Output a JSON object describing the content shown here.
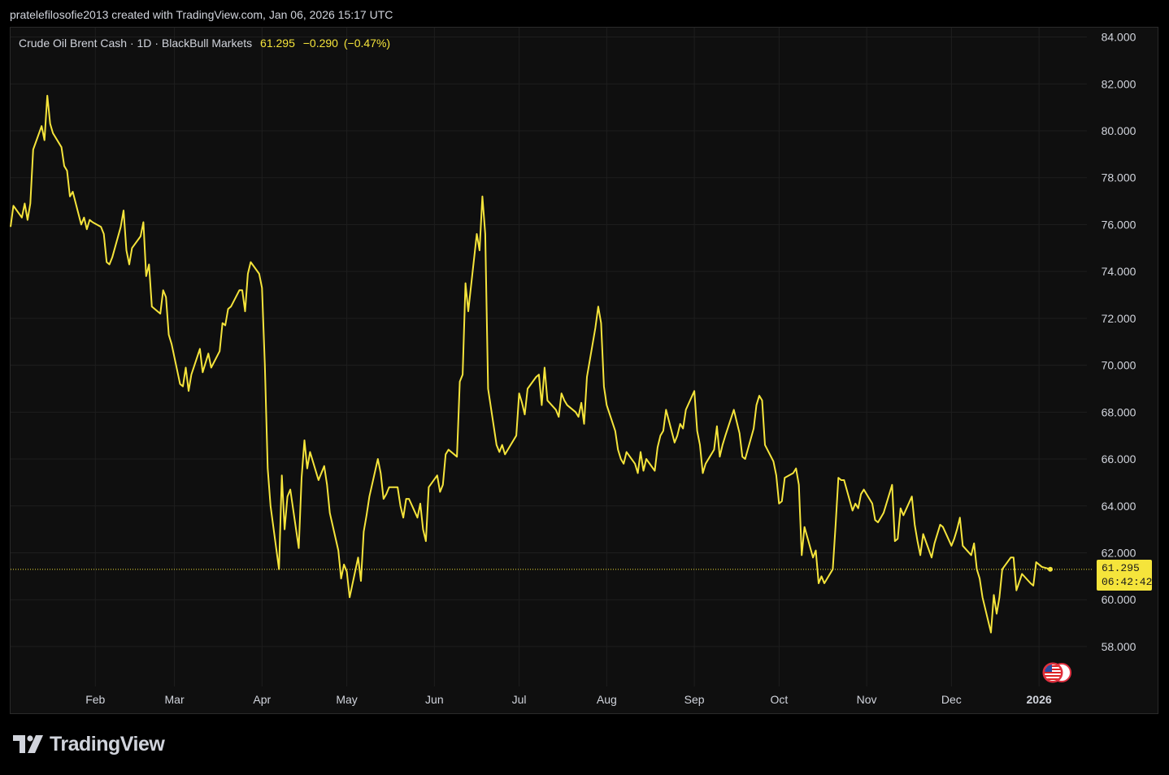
{
  "header": {
    "attribution": "pratelefilosofie2013 created with TradingView.com, Jan 06, 2026 15:17 UTC"
  },
  "legend": {
    "symbol": "Crude Oil Brent Cash",
    "sep1": "·",
    "interval": "1D",
    "sep2": "·",
    "source": "BlackBull Markets",
    "last": "61.295",
    "change": "−0.290",
    "change_pct": "(−0.47%)"
  },
  "price_tag": {
    "price": "61.295",
    "countdown": "06:42:42"
  },
  "logo": {
    "text": "TradingView"
  },
  "icons": {
    "logo": "tradingview-logo-icon",
    "flags": "us-flag-icon"
  },
  "colors": {
    "line": "#f5e43b",
    "background": "#0f0f0f",
    "grid": "#1e1e1e",
    "axis_text": "#d1d4dc"
  },
  "chart_data": {
    "type": "line",
    "title": "",
    "xlabel": "",
    "ylabel": "",
    "ylim": [
      56.3,
      84.4
    ],
    "y_ticks": [
      "58.000",
      "60.000",
      "62.000",
      "64.000",
      "66.000",
      "68.000",
      "70.000",
      "72.000",
      "74.000",
      "76.000",
      "78.000",
      "80.000",
      "82.000",
      "84.000"
    ],
    "x_ticks": [
      {
        "label": "Feb",
        "date": "2025-02-01"
      },
      {
        "label": "Mar",
        "date": "2025-03-01"
      },
      {
        "label": "Apr",
        "date": "2025-04-01"
      },
      {
        "label": "May",
        "date": "2025-05-01"
      },
      {
        "label": "Jun",
        "date": "2025-06-01"
      },
      {
        "label": "Jul",
        "date": "2025-07-01"
      },
      {
        "label": "Aug",
        "date": "2025-08-01"
      },
      {
        "label": "Sep",
        "date": "2025-09-01"
      },
      {
        "label": "Oct",
        "date": "2025-10-01"
      },
      {
        "label": "Nov",
        "date": "2025-11-01"
      },
      {
        "label": "Dec",
        "date": "2025-12-01"
      },
      {
        "label": "2026",
        "date": "2026-01-01",
        "bold": true
      }
    ],
    "last_price": 61.295,
    "grid": true,
    "series": [
      {
        "values": [
          [
            "2025-01-02",
            75.9
          ],
          [
            "2025-01-03",
            76.8
          ],
          [
            "2025-01-06",
            76.3
          ],
          [
            "2025-01-07",
            76.9
          ],
          [
            "2025-01-08",
            76.2
          ],
          [
            "2025-01-09",
            76.9
          ],
          [
            "2025-01-10",
            79.2
          ],
          [
            "2025-01-13",
            80.2
          ],
          [
            "2025-01-14",
            79.6
          ],
          [
            "2025-01-15",
            81.5
          ],
          [
            "2025-01-16",
            80.3
          ],
          [
            "2025-01-17",
            79.9
          ],
          [
            "2025-01-20",
            79.3
          ],
          [
            "2025-01-21",
            78.5
          ],
          [
            "2025-01-22",
            78.3
          ],
          [
            "2025-01-23",
            77.2
          ],
          [
            "2025-01-24",
            77.4
          ],
          [
            "2025-01-27",
            76.0
          ],
          [
            "2025-01-28",
            76.3
          ],
          [
            "2025-01-29",
            75.8
          ],
          [
            "2025-01-30",
            76.2
          ],
          [
            "2025-01-31",
            76.1
          ],
          [
            "2025-02-03",
            75.9
          ],
          [
            "2025-02-04",
            75.6
          ],
          [
            "2025-02-05",
            74.4
          ],
          [
            "2025-02-06",
            74.3
          ],
          [
            "2025-02-07",
            74.6
          ],
          [
            "2025-02-10",
            75.9
          ],
          [
            "2025-02-11",
            76.6
          ],
          [
            "2025-02-12",
            74.9
          ],
          [
            "2025-02-13",
            74.3
          ],
          [
            "2025-02-14",
            75.0
          ],
          [
            "2025-02-17",
            75.5
          ],
          [
            "2025-02-18",
            76.1
          ],
          [
            "2025-02-19",
            73.8
          ],
          [
            "2025-02-20",
            74.3
          ],
          [
            "2025-02-21",
            72.5
          ],
          [
            "2025-02-24",
            72.2
          ],
          [
            "2025-02-25",
            73.2
          ],
          [
            "2025-02-26",
            72.9
          ],
          [
            "2025-02-27",
            71.3
          ],
          [
            "2025-02-28",
            70.9
          ],
          [
            "2025-03-03",
            69.2
          ],
          [
            "2025-03-04",
            69.1
          ],
          [
            "2025-03-05",
            69.9
          ],
          [
            "2025-03-06",
            68.9
          ],
          [
            "2025-03-07",
            69.6
          ],
          [
            "2025-03-10",
            70.7
          ],
          [
            "2025-03-11",
            69.7
          ],
          [
            "2025-03-12",
            70.1
          ],
          [
            "2025-03-13",
            70.5
          ],
          [
            "2025-03-14",
            69.9
          ],
          [
            "2025-03-17",
            70.6
          ],
          [
            "2025-03-18",
            71.8
          ],
          [
            "2025-03-19",
            71.7
          ],
          [
            "2025-03-20",
            72.4
          ],
          [
            "2025-03-21",
            72.5
          ],
          [
            "2025-03-24",
            73.2
          ],
          [
            "2025-03-25",
            73.2
          ],
          [
            "2025-03-26",
            72.3
          ],
          [
            "2025-03-27",
            73.9
          ],
          [
            "2025-03-28",
            74.4
          ],
          [
            "2025-03-31",
            73.9
          ],
          [
            "2025-04-01",
            73.3
          ],
          [
            "2025-04-02",
            70.0
          ],
          [
            "2025-04-03",
            65.6
          ],
          [
            "2025-04-04",
            64.0
          ],
          [
            "2025-04-07",
            61.3
          ],
          [
            "2025-04-08",
            65.3
          ],
          [
            "2025-04-09",
            63.0
          ],
          [
            "2025-04-10",
            64.4
          ],
          [
            "2025-04-11",
            64.7
          ],
          [
            "2025-04-14",
            62.2
          ],
          [
            "2025-04-15",
            65.2
          ],
          [
            "2025-04-16",
            66.8
          ],
          [
            "2025-04-17",
            65.6
          ],
          [
            "2025-04-18",
            66.3
          ],
          [
            "2025-04-21",
            65.1
          ],
          [
            "2025-04-22",
            65.4
          ],
          [
            "2025-04-23",
            65.7
          ],
          [
            "2025-04-24",
            64.9
          ],
          [
            "2025-04-25",
            63.7
          ],
          [
            "2025-04-28",
            62.1
          ],
          [
            "2025-04-29",
            60.9
          ],
          [
            "2025-04-30",
            61.5
          ],
          [
            "2025-05-01",
            61.2
          ],
          [
            "2025-05-02",
            60.1
          ],
          [
            "2025-05-05",
            61.8
          ],
          [
            "2025-05-06",
            60.8
          ],
          [
            "2025-05-07",
            62.9
          ],
          [
            "2025-05-08",
            63.6
          ],
          [
            "2025-05-09",
            64.4
          ],
          [
            "2025-05-12",
            66.0
          ],
          [
            "2025-05-13",
            65.4
          ],
          [
            "2025-05-14",
            64.3
          ],
          [
            "2025-05-15",
            64.5
          ],
          [
            "2025-05-16",
            64.8
          ],
          [
            "2025-05-19",
            64.8
          ],
          [
            "2025-05-20",
            64.0
          ],
          [
            "2025-05-21",
            63.5
          ],
          [
            "2025-05-22",
            64.3
          ],
          [
            "2025-05-23",
            64.3
          ],
          [
            "2025-05-26",
            63.5
          ],
          [
            "2025-05-27",
            64.1
          ],
          [
            "2025-05-28",
            63.0
          ],
          [
            "2025-05-29",
            62.5
          ],
          [
            "2025-05-30",
            64.8
          ],
          [
            "2025-06-02",
            65.3
          ],
          [
            "2025-06-03",
            64.6
          ],
          [
            "2025-06-04",
            64.9
          ],
          [
            "2025-06-05",
            66.2
          ],
          [
            "2025-06-06",
            66.4
          ],
          [
            "2025-06-09",
            66.1
          ],
          [
            "2025-06-10",
            69.3
          ],
          [
            "2025-06-11",
            69.6
          ],
          [
            "2025-06-12",
            73.5
          ],
          [
            "2025-06-13",
            72.3
          ],
          [
            "2025-06-16",
            75.6
          ],
          [
            "2025-06-17",
            74.9
          ],
          [
            "2025-06-18",
            77.2
          ],
          [
            "2025-06-19",
            75.6
          ],
          [
            "2025-06-20",
            69.0
          ],
          [
            "2025-06-23",
            66.6
          ],
          [
            "2025-06-24",
            66.3
          ],
          [
            "2025-06-25",
            66.6
          ],
          [
            "2025-06-26",
            66.2
          ],
          [
            "2025-06-27",
            66.4
          ],
          [
            "2025-06-30",
            67.0
          ],
          [
            "2025-07-01",
            68.8
          ],
          [
            "2025-07-02",
            68.4
          ],
          [
            "2025-07-03",
            67.9
          ],
          [
            "2025-07-04",
            69.0
          ],
          [
            "2025-07-07",
            69.5
          ],
          [
            "2025-07-08",
            69.6
          ],
          [
            "2025-07-09",
            68.3
          ],
          [
            "2025-07-10",
            69.9
          ],
          [
            "2025-07-11",
            68.5
          ],
          [
            "2025-07-14",
            68.1
          ],
          [
            "2025-07-15",
            67.8
          ],
          [
            "2025-07-16",
            68.8
          ],
          [
            "2025-07-17",
            68.5
          ],
          [
            "2025-07-18",
            68.3
          ],
          [
            "2025-07-21",
            68.0
          ],
          [
            "2025-07-22",
            67.8
          ],
          [
            "2025-07-23",
            68.4
          ],
          [
            "2025-07-24",
            67.5
          ],
          [
            "2025-07-25",
            69.5
          ],
          [
            "2025-07-28",
            71.6
          ],
          [
            "2025-07-29",
            72.5
          ],
          [
            "2025-07-30",
            71.8
          ],
          [
            "2025-07-31",
            69.1
          ],
          [
            "2025-08-01",
            68.3
          ],
          [
            "2025-08-04",
            67.2
          ],
          [
            "2025-08-05",
            66.4
          ],
          [
            "2025-08-06",
            66.0
          ],
          [
            "2025-08-07",
            65.8
          ],
          [
            "2025-08-08",
            66.3
          ],
          [
            "2025-08-11",
            65.8
          ],
          [
            "2025-08-12",
            65.4
          ],
          [
            "2025-08-13",
            66.3
          ],
          [
            "2025-08-14",
            65.5
          ],
          [
            "2025-08-15",
            66.0
          ],
          [
            "2025-08-18",
            65.5
          ],
          [
            "2025-08-19",
            66.5
          ],
          [
            "2025-08-20",
            67.0
          ],
          [
            "2025-08-21",
            67.2
          ],
          [
            "2025-08-22",
            68.1
          ],
          [
            "2025-08-25",
            66.7
          ],
          [
            "2025-08-26",
            67.0
          ],
          [
            "2025-08-27",
            67.5
          ],
          [
            "2025-08-28",
            67.3
          ],
          [
            "2025-08-29",
            68.1
          ],
          [
            "2025-09-01",
            68.9
          ],
          [
            "2025-09-02",
            67.2
          ],
          [
            "2025-09-03",
            66.6
          ],
          [
            "2025-09-04",
            65.4
          ],
          [
            "2025-09-05",
            65.8
          ],
          [
            "2025-09-08",
            66.4
          ],
          [
            "2025-09-09",
            67.4
          ],
          [
            "2025-09-10",
            66.1
          ],
          [
            "2025-09-11",
            66.6
          ],
          [
            "2025-09-12",
            67.0
          ],
          [
            "2025-09-15",
            68.1
          ],
          [
            "2025-09-16",
            67.6
          ],
          [
            "2025-09-17",
            67.1
          ],
          [
            "2025-09-18",
            66.1
          ],
          [
            "2025-09-19",
            66.0
          ],
          [
            "2025-09-22",
            67.3
          ],
          [
            "2025-09-23",
            68.3
          ],
          [
            "2025-09-24",
            68.7
          ],
          [
            "2025-09-25",
            68.5
          ],
          [
            "2025-09-26",
            66.6
          ],
          [
            "2025-09-29",
            65.9
          ],
          [
            "2025-09-30",
            65.3
          ],
          [
            "2025-10-01",
            64.1
          ],
          [
            "2025-10-02",
            64.2
          ],
          [
            "2025-10-03",
            65.2
          ],
          [
            "2025-10-06",
            65.4
          ],
          [
            "2025-10-07",
            65.6
          ],
          [
            "2025-10-08",
            64.9
          ],
          [
            "2025-10-09",
            61.9
          ],
          [
            "2025-10-10",
            63.1
          ],
          [
            "2025-10-13",
            61.8
          ],
          [
            "2025-10-14",
            62.1
          ],
          [
            "2025-10-15",
            60.7
          ],
          [
            "2025-10-16",
            61.0
          ],
          [
            "2025-10-17",
            60.7
          ],
          [
            "2025-10-20",
            61.3
          ],
          [
            "2025-10-21",
            63.2
          ],
          [
            "2025-10-22",
            65.2
          ],
          [
            "2025-10-23",
            65.1
          ],
          [
            "2025-10-24",
            65.1
          ],
          [
            "2025-10-27",
            63.8
          ],
          [
            "2025-10-28",
            64.1
          ],
          [
            "2025-10-29",
            63.9
          ],
          [
            "2025-10-30",
            64.5
          ],
          [
            "2025-10-31",
            64.7
          ],
          [
            "2025-11-03",
            64.1
          ],
          [
            "2025-11-04",
            63.4
          ],
          [
            "2025-11-05",
            63.3
          ],
          [
            "2025-11-06",
            63.5
          ],
          [
            "2025-11-07",
            63.7
          ],
          [
            "2025-11-10",
            64.9
          ],
          [
            "2025-11-11",
            62.5
          ],
          [
            "2025-11-12",
            62.6
          ],
          [
            "2025-11-13",
            63.9
          ],
          [
            "2025-11-14",
            63.6
          ],
          [
            "2025-11-17",
            64.4
          ],
          [
            "2025-11-18",
            63.2
          ],
          [
            "2025-11-19",
            62.5
          ],
          [
            "2025-11-20",
            61.9
          ],
          [
            "2025-11-21",
            62.8
          ],
          [
            "2025-11-24",
            61.8
          ],
          [
            "2025-11-25",
            62.4
          ],
          [
            "2025-11-26",
            62.8
          ],
          [
            "2025-11-27",
            63.2
          ],
          [
            "2025-11-28",
            63.1
          ],
          [
            "2025-12-01",
            62.3
          ],
          [
            "2025-12-02",
            62.6
          ],
          [
            "2025-12-03",
            63.0
          ],
          [
            "2025-12-04",
            63.5
          ],
          [
            "2025-12-05",
            62.3
          ],
          [
            "2025-12-08",
            61.9
          ],
          [
            "2025-12-09",
            62.4
          ],
          [
            "2025-12-10",
            61.3
          ],
          [
            "2025-12-11",
            60.9
          ],
          [
            "2025-12-12",
            60.1
          ],
          [
            "2025-12-15",
            58.6
          ],
          [
            "2025-12-16",
            60.2
          ],
          [
            "2025-12-17",
            59.4
          ],
          [
            "2025-12-18",
            60.1
          ],
          [
            "2025-12-19",
            61.3
          ],
          [
            "2025-12-22",
            61.8
          ],
          [
            "2025-12-23",
            61.8
          ],
          [
            "2025-12-24",
            60.4
          ],
          [
            "2025-12-26",
            61.1
          ],
          [
            "2025-12-29",
            60.7
          ],
          [
            "2025-12-30",
            60.6
          ],
          [
            "2025-12-31",
            61.6
          ],
          [
            "2026-01-02",
            61.4
          ],
          [
            "2026-01-05",
            61.3
          ]
        ]
      }
    ]
  }
}
